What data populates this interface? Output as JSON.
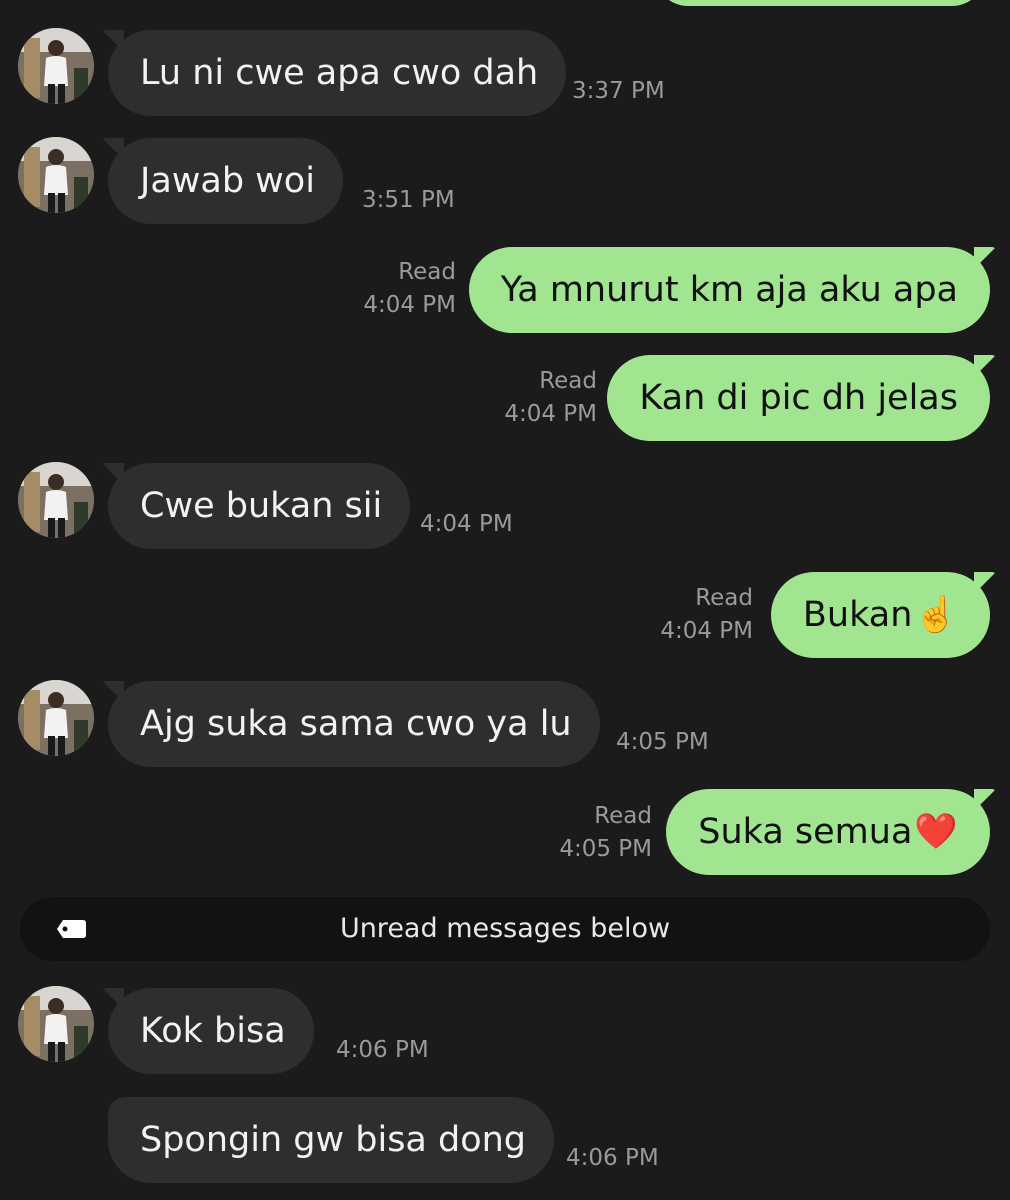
{
  "messages": [
    {
      "text": "Lu ni cwe apa cwo dah",
      "time": "3:37 PM"
    },
    {
      "text": "Jawab woi",
      "time": "3:51 PM"
    },
    {
      "text": "Ya mnurut km aja aku apa",
      "status": "Read",
      "time": "4:04 PM"
    },
    {
      "text": "Kan di pic dh jelas",
      "status": "Read",
      "time": "4:04 PM"
    },
    {
      "text": "Cwe bukan sii",
      "time": "4:04 PM"
    },
    {
      "text": "Bukan",
      "emoji": "☝️",
      "status": "Read",
      "time": "4:04 PM"
    },
    {
      "text": "Ajg suka sama cwo ya lu",
      "time": "4:05 PM"
    },
    {
      "text": "Suka semua",
      "emoji": "❤️",
      "status": "Read",
      "time": "4:05 PM"
    },
    {
      "text": "Kok bisa",
      "time": "4:06 PM"
    },
    {
      "text": "Spongin gw bisa dong",
      "time": "4:06 PM"
    }
  ],
  "unread_divider": {
    "label": "Unread messages below",
    "icon": "tag-icon"
  },
  "colors": {
    "background": "#1b1b1b",
    "incoming_bubble": "#2e2e2e",
    "outgoing_bubble": "#a1e591",
    "timestamp": "#9a9a9a"
  }
}
